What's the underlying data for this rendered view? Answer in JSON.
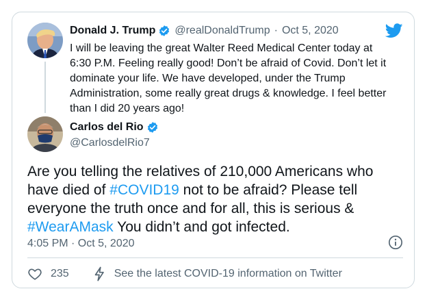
{
  "quoted_tweet": {
    "author_name": "Donald J. Trump",
    "handle": "@realDonaldTrump",
    "separator": "·",
    "date": "Oct 5, 2020",
    "text": "I will be leaving the great Walter Reed Medical Center today at 6:30 P.M. Feeling really good! Don’t be afraid of Covid. Don’t let it dominate your life. We have developed, under the Trump Administration, some really great drugs & knowledge. I feel better than I did 20 years ago!"
  },
  "tweet": {
    "author_name": "Carlos del Rio",
    "handle": "@CarlosdelRio7",
    "text_parts": [
      "Are you telling the relatives of 210,000 Americans who have died of ",
      "#COVID19",
      " not to be afraid?  Please tell everyone the truth once and for all, this is serious & ",
      "#WearAMask",
      " You didn’t and got infected."
    ],
    "timestamp": "4:05 PM · Oct 5, 2020",
    "likes": "235",
    "covid_link": "See the latest COVID-19 information on Twitter"
  },
  "icons": {
    "bird": "twitter-bird-icon",
    "verified": "verified-badge-icon",
    "info": "info-icon",
    "heart": "heart-icon",
    "bolt": "lightning-bolt-icon"
  },
  "colors": {
    "link": "#1d9bf0",
    "muted": "#536471",
    "border": "#cfd9de",
    "text": "#0f1419"
  }
}
